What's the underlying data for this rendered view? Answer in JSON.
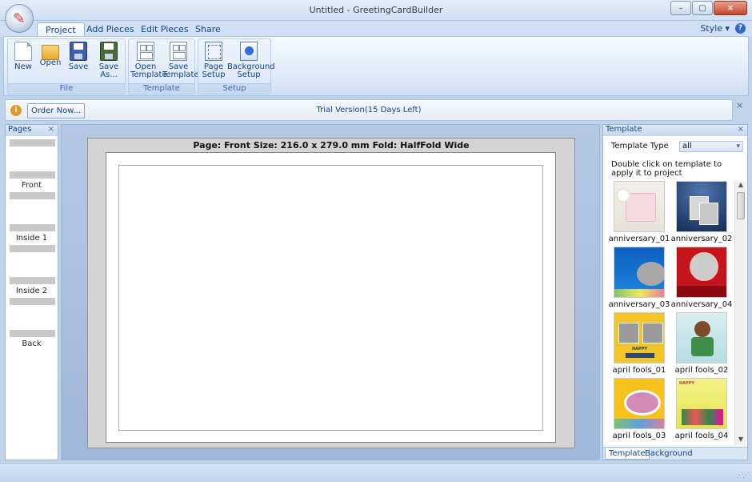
{
  "window": {
    "title": "Untitled - GreetingCardBuilder"
  },
  "tabs": [
    {
      "label": "Project",
      "active": true
    },
    {
      "label": "Add Pieces",
      "active": false
    },
    {
      "label": "Edit Pieces",
      "active": false
    },
    {
      "label": "Share",
      "active": false
    }
  ],
  "style_menu": "Style",
  "ribbon": {
    "groups": [
      {
        "label": "File",
        "buttons": [
          {
            "label1": "New",
            "label2": "",
            "icon": "new-document-icon"
          },
          {
            "label1": "Open",
            "label2": "",
            "icon": "open-folder-icon"
          },
          {
            "label1": "Save",
            "label2": "",
            "icon": "save-floppy-icon"
          },
          {
            "label1": "Save",
            "label2": "As...",
            "icon": "save-as-icon"
          }
        ]
      },
      {
        "label": "Template",
        "buttons": [
          {
            "label1": "Open",
            "label2": "Template",
            "icon": "open-template-icon"
          },
          {
            "label1": "Save",
            "label2": "Template",
            "icon": "save-template-icon"
          }
        ]
      },
      {
        "label": "Setup",
        "buttons": [
          {
            "label1": "Page",
            "label2": "Setup",
            "icon": "page-setup-icon"
          },
          {
            "label1": "Background",
            "label2": "Setup",
            "icon": "background-setup-icon"
          }
        ]
      }
    ]
  },
  "infobar": {
    "order_button": "Order Now...",
    "trial_text": "Trial Version(15 Days Left)"
  },
  "pages_panel": {
    "title": "Pages",
    "pages": [
      "Front",
      "Inside 1",
      "Inside 2",
      "Back"
    ]
  },
  "canvas": {
    "header": "Page: Front   Size: 216.0 x 279.0 mm   Fold: HalfFold Wide"
  },
  "template_panel": {
    "title": "Template",
    "type_label": "Template Type",
    "type_value": "all",
    "hint": "Double click on template to apply it to project",
    "items": [
      "anniversary_01",
      "anniversary_02",
      "anniversary_03",
      "anniversary_04",
      "april fools_01",
      "april fools_02",
      "april fools_03",
      "april fools_04"
    ],
    "bottom_tabs": [
      {
        "label": "Template",
        "active": true
      },
      {
        "label": "Background",
        "active": false
      }
    ]
  },
  "icons": {
    "info": "i",
    "close": "×",
    "help": "?",
    "minimize": "–",
    "maximize": "▢"
  },
  "thumb_captions": {
    "april_fools_01": "HAPPY",
    "april_fools_04": "HAPPY"
  },
  "colors": {
    "ribbon_blue": "#cfe0f4",
    "text_blue": "#15428b",
    "close_red": "#c4452c"
  }
}
